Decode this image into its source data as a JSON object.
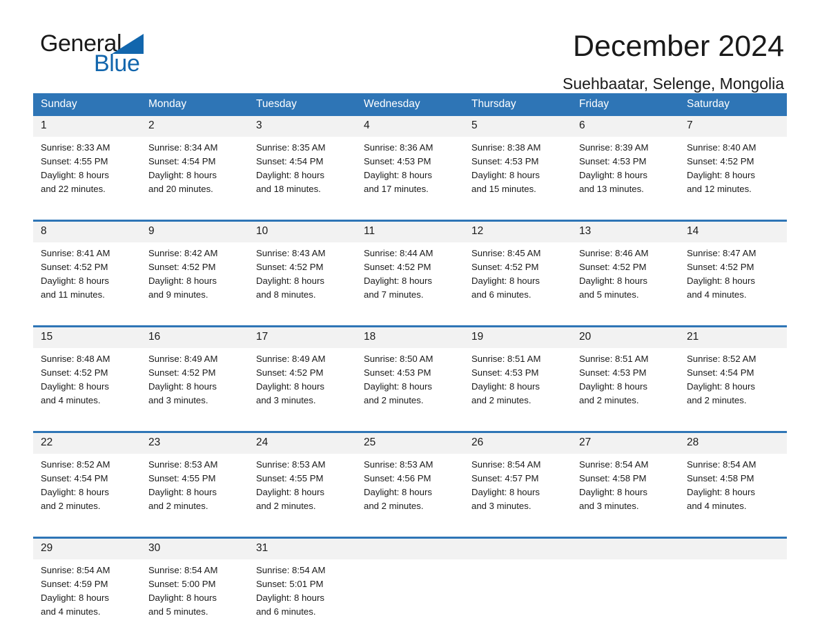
{
  "brand": {
    "word_one": "General",
    "word_two": "Blue",
    "triangle_icon": "blue-triangle-icon",
    "accent_color": "#1266ad"
  },
  "header": {
    "title": "December 2024",
    "location": "Suehbaatar, Selenge, Mongolia"
  },
  "colors": {
    "header_blue": "#2e75b6",
    "date_band_gray": "#f2f2f2",
    "text": "#1a1a1a"
  },
  "calendar": {
    "weekdays": [
      "Sunday",
      "Monday",
      "Tuesday",
      "Wednesday",
      "Thursday",
      "Friday",
      "Saturday"
    ],
    "weeks": [
      [
        {
          "day": "1",
          "sunrise": "Sunrise: 8:33 AM",
          "sunset": "Sunset: 4:55 PM",
          "daylight_1": "Daylight: 8 hours",
          "daylight_2": "and 22 minutes."
        },
        {
          "day": "2",
          "sunrise": "Sunrise: 8:34 AM",
          "sunset": "Sunset: 4:54 PM",
          "daylight_1": "Daylight: 8 hours",
          "daylight_2": "and 20 minutes."
        },
        {
          "day": "3",
          "sunrise": "Sunrise: 8:35 AM",
          "sunset": "Sunset: 4:54 PM",
          "daylight_1": "Daylight: 8 hours",
          "daylight_2": "and 18 minutes."
        },
        {
          "day": "4",
          "sunrise": "Sunrise: 8:36 AM",
          "sunset": "Sunset: 4:53 PM",
          "daylight_1": "Daylight: 8 hours",
          "daylight_2": "and 17 minutes."
        },
        {
          "day": "5",
          "sunrise": "Sunrise: 8:38 AM",
          "sunset": "Sunset: 4:53 PM",
          "daylight_1": "Daylight: 8 hours",
          "daylight_2": "and 15 minutes."
        },
        {
          "day": "6",
          "sunrise": "Sunrise: 8:39 AM",
          "sunset": "Sunset: 4:53 PM",
          "daylight_1": "Daylight: 8 hours",
          "daylight_2": "and 13 minutes."
        },
        {
          "day": "7",
          "sunrise": "Sunrise: 8:40 AM",
          "sunset": "Sunset: 4:52 PM",
          "daylight_1": "Daylight: 8 hours",
          "daylight_2": "and 12 minutes."
        }
      ],
      [
        {
          "day": "8",
          "sunrise": "Sunrise: 8:41 AM",
          "sunset": "Sunset: 4:52 PM",
          "daylight_1": "Daylight: 8 hours",
          "daylight_2": "and 11 minutes."
        },
        {
          "day": "9",
          "sunrise": "Sunrise: 8:42 AM",
          "sunset": "Sunset: 4:52 PM",
          "daylight_1": "Daylight: 8 hours",
          "daylight_2": "and 9 minutes."
        },
        {
          "day": "10",
          "sunrise": "Sunrise: 8:43 AM",
          "sunset": "Sunset: 4:52 PM",
          "daylight_1": "Daylight: 8 hours",
          "daylight_2": "and 8 minutes."
        },
        {
          "day": "11",
          "sunrise": "Sunrise: 8:44 AM",
          "sunset": "Sunset: 4:52 PM",
          "daylight_1": "Daylight: 8 hours",
          "daylight_2": "and 7 minutes."
        },
        {
          "day": "12",
          "sunrise": "Sunrise: 8:45 AM",
          "sunset": "Sunset: 4:52 PM",
          "daylight_1": "Daylight: 8 hours",
          "daylight_2": "and 6 minutes."
        },
        {
          "day": "13",
          "sunrise": "Sunrise: 8:46 AM",
          "sunset": "Sunset: 4:52 PM",
          "daylight_1": "Daylight: 8 hours",
          "daylight_2": "and 5 minutes."
        },
        {
          "day": "14",
          "sunrise": "Sunrise: 8:47 AM",
          "sunset": "Sunset: 4:52 PM",
          "daylight_1": "Daylight: 8 hours",
          "daylight_2": "and 4 minutes."
        }
      ],
      [
        {
          "day": "15",
          "sunrise": "Sunrise: 8:48 AM",
          "sunset": "Sunset: 4:52 PM",
          "daylight_1": "Daylight: 8 hours",
          "daylight_2": "and 4 minutes."
        },
        {
          "day": "16",
          "sunrise": "Sunrise: 8:49 AM",
          "sunset": "Sunset: 4:52 PM",
          "daylight_1": "Daylight: 8 hours",
          "daylight_2": "and 3 minutes."
        },
        {
          "day": "17",
          "sunrise": "Sunrise: 8:49 AM",
          "sunset": "Sunset: 4:52 PM",
          "daylight_1": "Daylight: 8 hours",
          "daylight_2": "and 3 minutes."
        },
        {
          "day": "18",
          "sunrise": "Sunrise: 8:50 AM",
          "sunset": "Sunset: 4:53 PM",
          "daylight_1": "Daylight: 8 hours",
          "daylight_2": "and 2 minutes."
        },
        {
          "day": "19",
          "sunrise": "Sunrise: 8:51 AM",
          "sunset": "Sunset: 4:53 PM",
          "daylight_1": "Daylight: 8 hours",
          "daylight_2": "and 2 minutes."
        },
        {
          "day": "20",
          "sunrise": "Sunrise: 8:51 AM",
          "sunset": "Sunset: 4:53 PM",
          "daylight_1": "Daylight: 8 hours",
          "daylight_2": "and 2 minutes."
        },
        {
          "day": "21",
          "sunrise": "Sunrise: 8:52 AM",
          "sunset": "Sunset: 4:54 PM",
          "daylight_1": "Daylight: 8 hours",
          "daylight_2": "and 2 minutes."
        }
      ],
      [
        {
          "day": "22",
          "sunrise": "Sunrise: 8:52 AM",
          "sunset": "Sunset: 4:54 PM",
          "daylight_1": "Daylight: 8 hours",
          "daylight_2": "and 2 minutes."
        },
        {
          "day": "23",
          "sunrise": "Sunrise: 8:53 AM",
          "sunset": "Sunset: 4:55 PM",
          "daylight_1": "Daylight: 8 hours",
          "daylight_2": "and 2 minutes."
        },
        {
          "day": "24",
          "sunrise": "Sunrise: 8:53 AM",
          "sunset": "Sunset: 4:55 PM",
          "daylight_1": "Daylight: 8 hours",
          "daylight_2": "and 2 minutes."
        },
        {
          "day": "25",
          "sunrise": "Sunrise: 8:53 AM",
          "sunset": "Sunset: 4:56 PM",
          "daylight_1": "Daylight: 8 hours",
          "daylight_2": "and 2 minutes."
        },
        {
          "day": "26",
          "sunrise": "Sunrise: 8:54 AM",
          "sunset": "Sunset: 4:57 PM",
          "daylight_1": "Daylight: 8 hours",
          "daylight_2": "and 3 minutes."
        },
        {
          "day": "27",
          "sunrise": "Sunrise: 8:54 AM",
          "sunset": "Sunset: 4:58 PM",
          "daylight_1": "Daylight: 8 hours",
          "daylight_2": "and 3 minutes."
        },
        {
          "day": "28",
          "sunrise": "Sunrise: 8:54 AM",
          "sunset": "Sunset: 4:58 PM",
          "daylight_1": "Daylight: 8 hours",
          "daylight_2": "and 4 minutes."
        }
      ],
      [
        {
          "day": "29",
          "sunrise": "Sunrise: 8:54 AM",
          "sunset": "Sunset: 4:59 PM",
          "daylight_1": "Daylight: 8 hours",
          "daylight_2": "and 4 minutes."
        },
        {
          "day": "30",
          "sunrise": "Sunrise: 8:54 AM",
          "sunset": "Sunset: 5:00 PM",
          "daylight_1": "Daylight: 8 hours",
          "daylight_2": "and 5 minutes."
        },
        {
          "day": "31",
          "sunrise": "Sunrise: 8:54 AM",
          "sunset": "Sunset: 5:01 PM",
          "daylight_1": "Daylight: 8 hours",
          "daylight_2": "and 6 minutes."
        },
        {
          "day": "",
          "sunrise": "",
          "sunset": "",
          "daylight_1": "",
          "daylight_2": ""
        },
        {
          "day": "",
          "sunrise": "",
          "sunset": "",
          "daylight_1": "",
          "daylight_2": ""
        },
        {
          "day": "",
          "sunrise": "",
          "sunset": "",
          "daylight_1": "",
          "daylight_2": ""
        },
        {
          "day": "",
          "sunrise": "",
          "sunset": "",
          "daylight_1": "",
          "daylight_2": ""
        }
      ]
    ]
  }
}
